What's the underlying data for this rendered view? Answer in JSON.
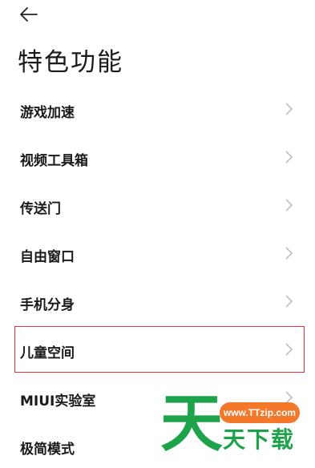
{
  "header": {
    "back_icon": "arrow-left-icon",
    "title": "特色功能"
  },
  "list": {
    "items": [
      {
        "label": "游戏加速"
      },
      {
        "label": "视频工具箱"
      },
      {
        "label": "传送门"
      },
      {
        "label": "自由窗口"
      },
      {
        "label": "手机分身"
      },
      {
        "label": "儿童空间"
      },
      {
        "label": "MIUI实验室"
      },
      {
        "label": "极简模式"
      }
    ],
    "chevron_icon": "chevron-right-icon",
    "highlight_color": "#e0303a"
  },
  "watermark": {
    "logo_char": "天",
    "url": "www.TTzip.com",
    "name": "天下载",
    "brand_green": "#1fa34a",
    "brand_orange": "#f4782a"
  }
}
